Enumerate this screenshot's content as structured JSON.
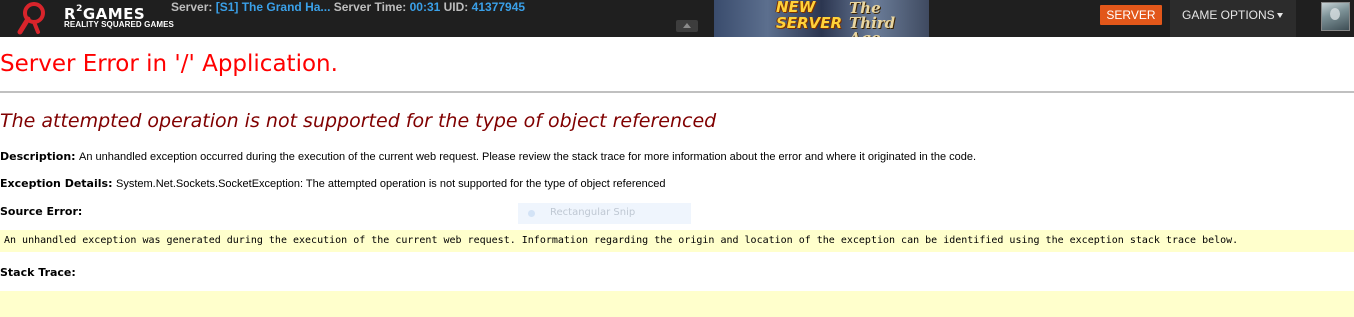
{
  "topbar": {
    "brand_name": "R²GAMES",
    "brand_main": "R",
    "brand_sup": "2",
    "brand_rest": "GAMES",
    "tagline": "REALITY SQUARED GAMES",
    "server_label": "Server:",
    "server_value": "[S1] The Grand Ha...",
    "time_label": "Server Time:",
    "time_value": "00:31",
    "uid_label": "UID:",
    "uid_value": "41377945",
    "banner": {
      "line1": "NEW",
      "line2": "SERVER",
      "title": "The Third Age"
    },
    "server_button": "SERVER",
    "game_options": "GAME OPTIONS",
    "accent_color": "#e2571a",
    "value_color": "#3aa0e8"
  },
  "error": {
    "title": "Server Error in '/' Application.",
    "heading": "The attempted operation is not supported for the type of object referenced",
    "description_label": "Description:",
    "description_text": "An unhandled exception occurred during the execution of the current web request. Please review the stack trace for more information about the error and where it originated in the code.",
    "exception_label": "Exception Details:",
    "exception_text": "System.Net.Sockets.SocketException: The attempted operation is not supported for the type of object referenced",
    "source_label": "Source Error:",
    "source_code": "An unhandled exception was generated during the execution of the current web request. Information regarding the origin and location of the exception can be identified using the exception stack trace below.",
    "stack_label": "Stack Trace:",
    "title_color": "#ff0000",
    "heading_color": "#800000",
    "code_bg": "#ffffcc"
  },
  "overlay": {
    "snip_label": "Rectangular Snip"
  }
}
